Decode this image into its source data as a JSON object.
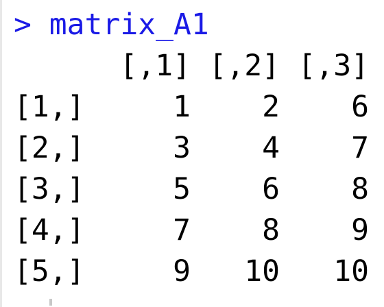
{
  "console": {
    "prompt_symbol": ">",
    "command": "matrix_A1",
    "prompt_color": "#1a1ae6",
    "output_color": "#000000"
  },
  "matrix": {
    "column_headers": [
      "[,1]",
      "[,2]",
      "[,3]"
    ],
    "rows": [
      {
        "label": "[1,]",
        "values": [
          "1",
          "2",
          "6"
        ]
      },
      {
        "label": "[2,]",
        "values": [
          "3",
          "4",
          "7"
        ]
      },
      {
        "label": "[3,]",
        "values": [
          "5",
          "6",
          "8"
        ]
      },
      {
        "label": "[4,]",
        "values": [
          "7",
          "8",
          "9"
        ]
      },
      {
        "label": "[5,]",
        "values": [
          "9",
          "10",
          "10"
        ]
      }
    ]
  }
}
